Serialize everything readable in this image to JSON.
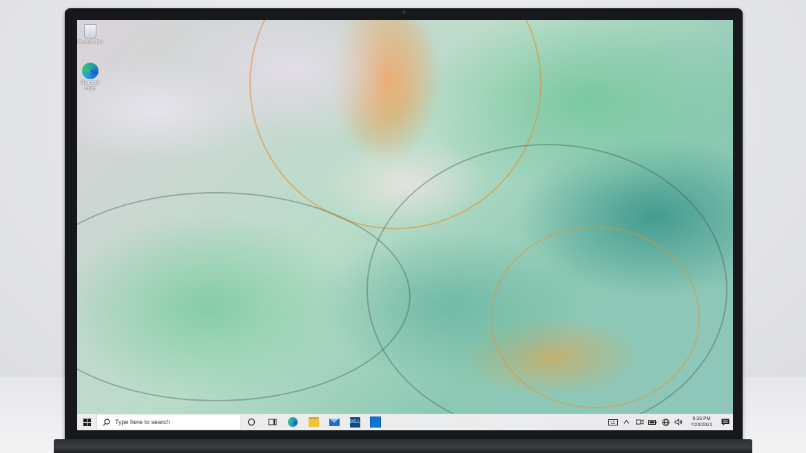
{
  "desktop": {
    "icons": [
      {
        "label": "Recycle Bin",
        "icon": "recycle-bin-icon"
      },
      {
        "label": "Microsoft Edge",
        "icon": "edge-icon"
      }
    ]
  },
  "taskbar": {
    "start_icon": "windows-logo-icon",
    "search": {
      "placeholder": "Type here to search",
      "icon": "search-icon"
    },
    "pinned": [
      {
        "name": "cortana",
        "icon": "circle-icon"
      },
      {
        "name": "task-view",
        "icon": "task-view-icon"
      },
      {
        "name": "microsoft-edge",
        "icon": "edge-icon"
      },
      {
        "name": "file-explorer",
        "icon": "folder-icon"
      },
      {
        "name": "mail",
        "icon": "mail-icon"
      },
      {
        "name": "dell",
        "icon": "dell-icon",
        "label": "DELL"
      },
      {
        "name": "store",
        "icon": "store-icon"
      }
    ],
    "tray": [
      {
        "name": "keyboard",
        "icon": "keyboard-icon"
      },
      {
        "name": "show-hidden",
        "icon": "chevron-up-icon"
      },
      {
        "name": "meet-now",
        "icon": "meet-now-icon"
      },
      {
        "name": "battery",
        "icon": "battery-icon"
      },
      {
        "name": "network",
        "icon": "globe-icon"
      },
      {
        "name": "volume",
        "icon": "speaker-icon"
      }
    ],
    "clock": {
      "time": "9:33 PM",
      "date": "7/20/2021"
    },
    "notifications_icon": "notification-icon"
  }
}
